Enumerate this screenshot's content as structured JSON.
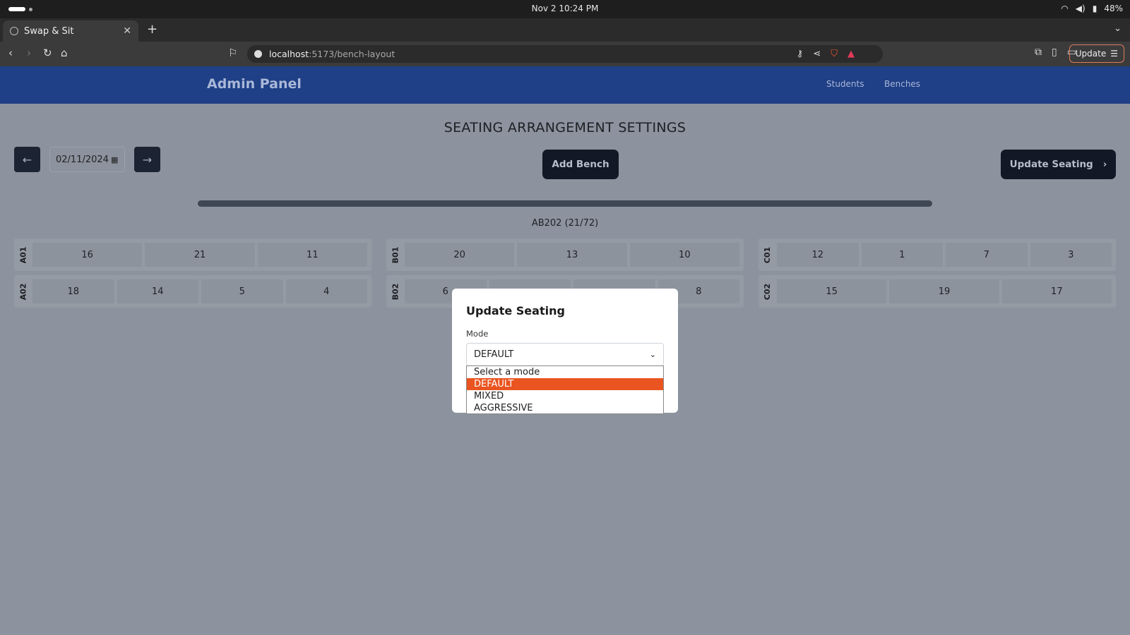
{
  "os": {
    "clock": "Nov 2  10:24 PM",
    "battery": "48%",
    "icons": [
      "wifi-icon",
      "volume-icon",
      "battery-icon"
    ]
  },
  "browser": {
    "tab_title": "Swap & Sit",
    "url_host": "localhost",
    "url_path": ":5173/bench-layout",
    "update_label": "Update"
  },
  "app": {
    "brand": "Admin Panel",
    "nav": [
      "Students",
      "Benches"
    ]
  },
  "page": {
    "title": "SEATING ARRANGEMENT SETTINGS",
    "date_value": "02/11/2024",
    "add_bench_label": "Add Bench",
    "update_seating_label": "Update Seating",
    "room_label": "AB202 (21/72)",
    "progress_fraction": 0.29
  },
  "benches": [
    {
      "id": "A01",
      "seats": [
        "16",
        "21",
        "11"
      ]
    },
    {
      "id": "B01",
      "seats": [
        "20",
        "13",
        "10"
      ]
    },
    {
      "id": "C01",
      "seats": [
        "12",
        "1",
        "7",
        "3"
      ]
    },
    {
      "id": "A02",
      "seats": [
        "18",
        "14",
        "5",
        "4"
      ]
    },
    {
      "id": "B02",
      "seats": [
        "6",
        "",
        "",
        "8"
      ]
    },
    {
      "id": "C02",
      "seats": [
        "15",
        "19",
        "17"
      ]
    }
  ],
  "modal": {
    "title": "Update Seating",
    "mode_label": "Mode",
    "selected_mode": "DEFAULT",
    "options": [
      "Select a mode",
      "DEFAULT",
      "MIXED",
      "AGGRESSIVE"
    ],
    "highlighted_option": "DEFAULT"
  }
}
